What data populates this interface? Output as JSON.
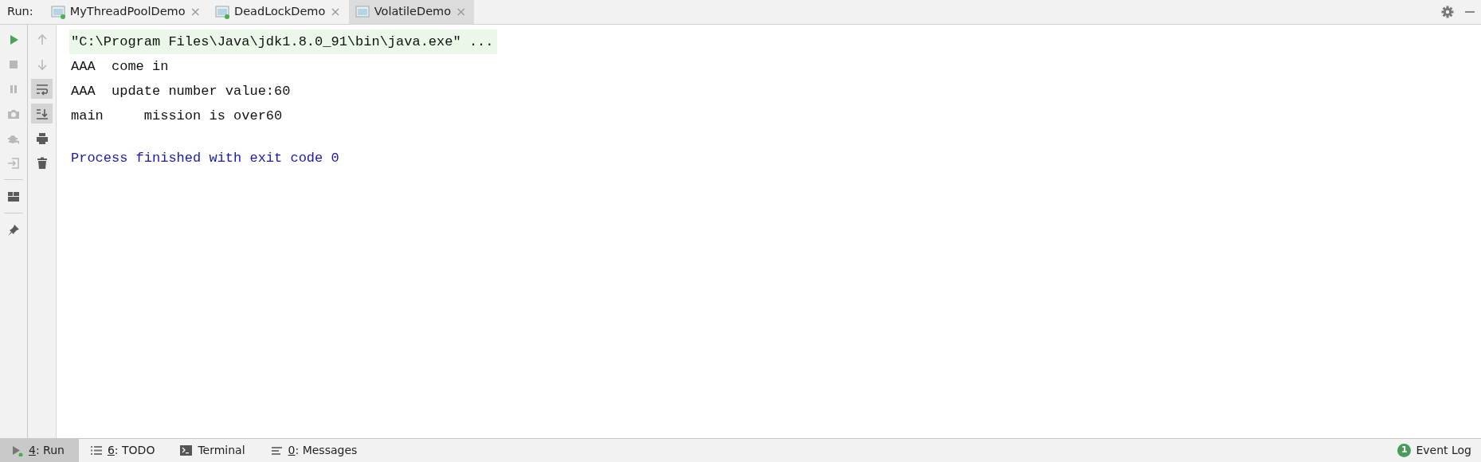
{
  "run_bar": {
    "label": "Run:",
    "tabs": [
      {
        "label": "MyThreadPoolDemo",
        "close": "×",
        "running": true,
        "selected": false
      },
      {
        "label": "DeadLockDemo",
        "close": "×",
        "running": true,
        "selected": false
      },
      {
        "label": "VolatileDemo",
        "close": "×",
        "running": false,
        "selected": true
      }
    ]
  },
  "left_toolbar": [
    {
      "kind": "run",
      "disabled": false
    },
    {
      "kind": "stop",
      "disabled": true
    },
    {
      "kind": "pause",
      "disabled": true
    },
    {
      "kind": "camera",
      "disabled": true
    },
    {
      "kind": "bug",
      "disabled": true
    },
    {
      "kind": "exit",
      "disabled": true
    },
    {
      "kind": "separator"
    },
    {
      "kind": "layout",
      "disabled": false
    },
    {
      "kind": "separator"
    },
    {
      "kind": "pin",
      "disabled": false
    }
  ],
  "console_toolbar": [
    {
      "kind": "up",
      "disabled": true,
      "toggled": false
    },
    {
      "kind": "down",
      "disabled": true,
      "toggled": false
    },
    {
      "kind": "wrap",
      "disabled": false,
      "toggled": true
    },
    {
      "kind": "scroll-end",
      "disabled": false,
      "toggled": true
    },
    {
      "kind": "print",
      "disabled": false,
      "toggled": false
    },
    {
      "kind": "trash",
      "disabled": false,
      "toggled": false
    }
  ],
  "console": [
    {
      "kind": "command",
      "text": "\"C:\\Program Files\\Java\\jdk1.8.0_91\\bin\\java.exe\" ..."
    },
    {
      "kind": "output",
      "text": "AAA  come in"
    },
    {
      "kind": "output",
      "text": "AAA  update number value:60"
    },
    {
      "kind": "output",
      "text": "main     mission is over60"
    },
    {
      "kind": "exit",
      "text": "Process finished with exit code 0"
    }
  ],
  "status_bar": {
    "tools": [
      {
        "kind": "run",
        "key": "4",
        "label": ": Run",
        "selected": true
      },
      {
        "kind": "todo",
        "key": "6",
        "label": ": TODO",
        "selected": false
      },
      {
        "kind": "terminal",
        "label": "Terminal",
        "selected": false
      },
      {
        "kind": "messages",
        "key": "0",
        "label": ": Messages",
        "selected": false
      }
    ],
    "event_log": {
      "count": "1",
      "label": "Event Log"
    }
  }
}
